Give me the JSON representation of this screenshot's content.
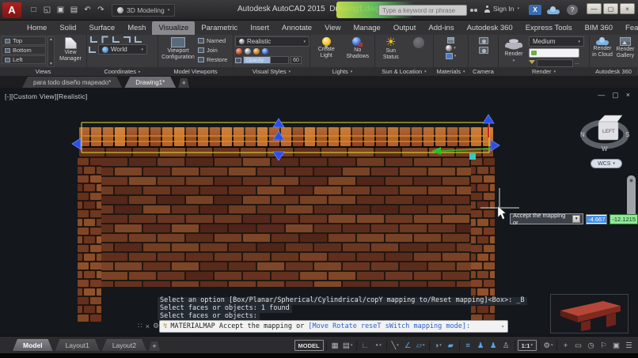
{
  "colors": {
    "selection_yellow": "#e6e032",
    "mapping_orange": "#e0901c",
    "grip_blue": "#2b50e8",
    "axis_green": "#28c028",
    "value_green_bg": "#90e89a",
    "value_blue_bg": "#3f8fe8",
    "brick_base": "#7b3522"
  },
  "title_bar": {
    "app_title": "Autodesk AutoCAD 2015",
    "doc_title": "Drawing1.dwg",
    "workspace": "3D Modeling",
    "search_placeholder": "Type a keyword or phrase",
    "sign_in_label": "Sign In",
    "exchange_label": "X",
    "help_label": "?",
    "win_min": "—",
    "win_restore": "▢",
    "win_close": "×",
    "qat_icons": [
      {
        "name": "new-file-icon",
        "glyph": "□"
      },
      {
        "name": "open-file-icon",
        "glyph": "◱"
      },
      {
        "name": "save-file-icon",
        "glyph": "▣"
      },
      {
        "name": "plot-icon",
        "glyph": "▤"
      },
      {
        "name": "undo-icon",
        "glyph": "↶"
      },
      {
        "name": "redo-icon",
        "glyph": "↷"
      }
    ]
  },
  "ribbon": {
    "tabs": [
      {
        "label": "Home"
      },
      {
        "label": "Solid"
      },
      {
        "label": "Surface"
      },
      {
        "label": "Mesh"
      },
      {
        "label": "Visualize",
        "active": true
      },
      {
        "label": "Parametric"
      },
      {
        "label": "Insert"
      },
      {
        "label": "Annotate"
      },
      {
        "label": "View"
      },
      {
        "label": "Manage"
      },
      {
        "label": "Output"
      },
      {
        "label": "Add-ins"
      },
      {
        "label": "Autodesk 360"
      },
      {
        "label": "Express Tools"
      },
      {
        "label": "BIM 360"
      },
      {
        "label": "Featured Apps"
      }
    ],
    "views": {
      "label": "Views",
      "items": [
        "Top",
        "Bottom",
        "Left"
      ],
      "view_manager": "View Manager"
    },
    "coordinates": {
      "label": "Coordinates",
      "ucs_name": "World"
    },
    "model_viewports": {
      "label": "Model Viewports",
      "viewport_configuration": "Viewport Configuration",
      "named": "Named",
      "join": "Join",
      "restore": "Restore"
    },
    "visual_styles": {
      "label": "Visual Styles",
      "current_style": "Realistic",
      "opacity_label": "Opacity",
      "opacity_value": "60"
    },
    "lights": {
      "label": "Lights",
      "create_light": "Create Light",
      "no_shadows": "No Shadows"
    },
    "sun_location": {
      "label": "Sun & Location",
      "sun_status": "Sun Status"
    },
    "materials": {
      "label": "Materials"
    },
    "camera": {
      "label": "Camera"
    },
    "render": {
      "label": "Render",
      "render_button": "Render",
      "quality": "Medium"
    },
    "autodesk_360": {
      "label": "Autodesk 360",
      "render_in_cloud": "Render in Cloud",
      "render_gallery": "Render Gallery"
    }
  },
  "file_tabs": {
    "tab1": "para todo diseño mapeado*",
    "tab2": "Drawing1*",
    "add": "+"
  },
  "viewport": {
    "control_minus": "[-]",
    "control_view": "[Custom View]",
    "control_style": "[Realistic]",
    "viewcube_face": "LEFT",
    "compass_n": "N",
    "compass_w": "W",
    "compass_s": "S",
    "wcs_label": "WCS",
    "win_min": "—",
    "win_restore": "▢",
    "win_close": "×"
  },
  "dynamic_input": {
    "prompt": "Accept the mapping or",
    "x_value": "-4.667",
    "y_value": "-12.1215"
  },
  "command_line": {
    "history": [
      "Select an option [Box/Planar/Spherical/Cylindrical/copY mapping to/Reset mapping]<Box>: _B",
      "Select faces or objects: 1 found",
      "Select faces or objects:"
    ],
    "command_name": "MATERIALMAP",
    "prompt_text": " Accept the mapping or ",
    "options_text": "[Move Rotate reseT sWitch mapping mode]:",
    "grip_glyph": "∷",
    "close_glyph": "×",
    "wrench_glyph": "⚙",
    "bolt_glyph": "↯",
    "dropdown_glyph": "▾"
  },
  "statusbar": {
    "layout_tabs": [
      {
        "name": "model-tab",
        "label": "Model",
        "active": true
      },
      {
        "name": "layout1-tab",
        "label": "Layout1"
      },
      {
        "name": "layout2-tab",
        "label": "Layout2"
      }
    ],
    "add_layout": "+",
    "icons": [
      {
        "name": "model-space-toggle",
        "label": "MODEL"
      },
      {
        "name": "grid-display-icon",
        "glyph": "▦",
        "sep": true
      },
      {
        "name": "snap-mode-icon",
        "glyph": "▤",
        "dropdown": true
      },
      {
        "name": "infer-constraints-icon",
        "glyph": "∟",
        "active": true,
        "sep": true
      },
      {
        "name": "dynamic-input-icon",
        "glyph": "◔",
        "dropdown": true
      },
      {
        "name": "ortho-mode-icon",
        "glyph": "╲",
        "dropdown": true,
        "sep": true
      },
      {
        "name": "polar-tracking-icon",
        "glyph": "∠",
        "active": true
      },
      {
        "name": "isometric-drafting-icon",
        "glyph": "▱",
        "active": true,
        "dropdown": true
      },
      {
        "name": "object-snap-tracking-icon",
        "glyph": "◑",
        "active": true,
        "dropdown": true,
        "sep": true
      },
      {
        "name": "object-snap-icon",
        "glyph": "▰",
        "active": true
      },
      {
        "name": "lineweight-icon",
        "glyph": "≡",
        "active": true,
        "sep": true
      },
      {
        "name": "annotation-visibility-icon",
        "glyph": "♟",
        "active": true
      },
      {
        "name": "autoscale-icon",
        "glyph": "♟",
        "active": true
      },
      {
        "name": "annotation-people-icon",
        "glyph": "♙"
      },
      {
        "name": "annotation-scale-control",
        "label": "1:1",
        "dropdown": true,
        "sep": true
      },
      {
        "name": "workspace-switcher-icon",
        "glyph": "⚙",
        "dropdown": true,
        "sep": true
      },
      {
        "name": "annotation-monitor-icon",
        "glyph": "+",
        "sep": true
      },
      {
        "name": "isolate-objects-icon",
        "glyph": "▭"
      },
      {
        "name": "graphics-performance-icon",
        "glyph": "◷"
      },
      {
        "name": "quick-properties-icon",
        "glyph": "⚐"
      },
      {
        "name": "clean-screen-icon",
        "glyph": "▣"
      },
      {
        "name": "customization-menu-icon",
        "glyph": "☰"
      }
    ]
  }
}
